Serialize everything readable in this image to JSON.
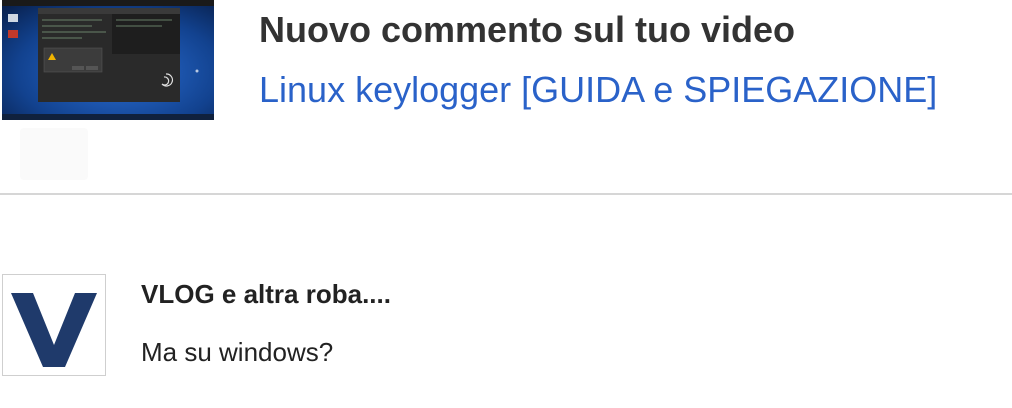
{
  "notification": {
    "heading": "Nuovo commento sul tuo video",
    "video_title": "Linux keylogger [GUIDA e SPIEGAZIONE]"
  },
  "comment": {
    "author": "VLOG e altra roba....",
    "text": "Ma su windows?"
  },
  "icons": {
    "thumbnail": "video-thumbnail-image",
    "avatar": "channel-avatar-v-logo",
    "faint": "placeholder-icon"
  },
  "colors": {
    "link": "#2a62c9",
    "heading": "#333333",
    "avatar_logo": "#1f3a6b",
    "divider": "#d6d6d6"
  }
}
